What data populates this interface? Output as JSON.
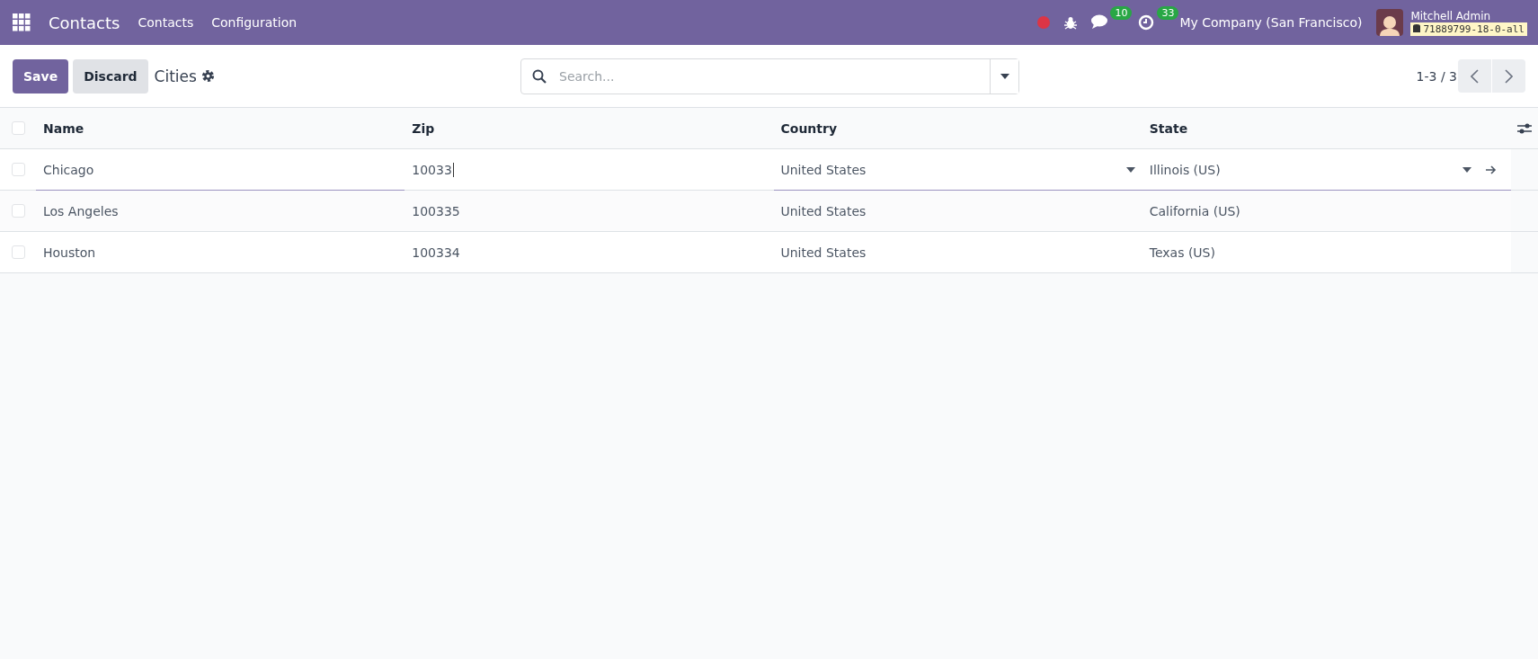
{
  "navbar": {
    "app": "Contacts",
    "menu": [
      "Contacts",
      "Configuration"
    ],
    "messages_count": "10",
    "activities_count": "33",
    "company": "My Company (San Francisco)",
    "user": "Mitchell Admin",
    "database": "71889799-18-0-all"
  },
  "control_panel": {
    "save": "Save",
    "discard": "Discard",
    "title": "Cities",
    "search": {
      "placeholder": "Search..."
    },
    "pager": "1-3 / 3"
  },
  "table": {
    "all_checked": false,
    "columns": [
      "Name",
      "Zip",
      "Country",
      "State"
    ],
    "rows": [
      {
        "checked": false,
        "editing": true,
        "cells": [
          "Chicago",
          "10033",
          "United States",
          "Illinois (US)"
        ]
      },
      {
        "checked": false,
        "editing": false,
        "cells": [
          "Los Angeles",
          "100335",
          "United States",
          "California (US)"
        ]
      },
      {
        "checked": false,
        "editing": false,
        "cells": [
          "Houston",
          "100334",
          "United States",
          "Texas (US)"
        ]
      }
    ]
  }
}
